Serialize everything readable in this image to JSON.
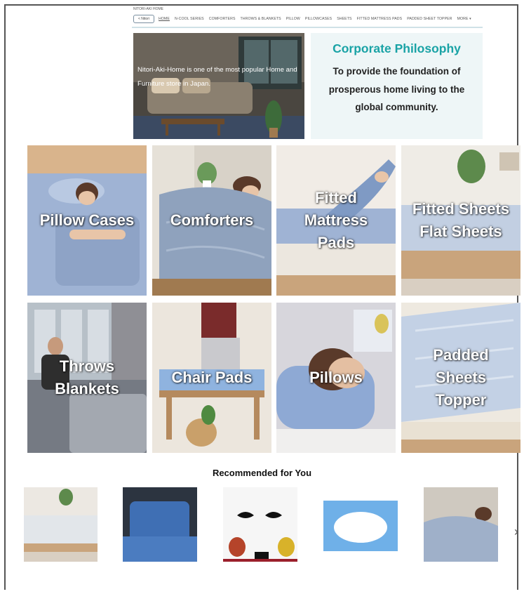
{
  "header": {
    "store_tag": "NITORI-AKI HOME",
    "nav_button": "< Nitori",
    "nav_items": [
      "HOME",
      "N-COOL SERIES",
      "COMFORTERS",
      "THROWS & BLANKETS",
      "PILLOW",
      "PILLOWCASES",
      "SHEETS",
      "FITTED MATTRESS PADS",
      "PADDED SHEET TOPPER",
      "MORE ▾"
    ]
  },
  "hero": {
    "text": "Nitori-Aki-Home is one of the most popular Home and Furniture store in Japan."
  },
  "philosophy": {
    "title": "Corporate Philosophy",
    "body": "To provide the foundation of prosperous home living to the global community."
  },
  "categories": [
    {
      "label": "Pillow Cases"
    },
    {
      "label": "Comforters"
    },
    {
      "label": "Fitted\nMattress\nPads"
    },
    {
      "label": "Fitted Sheets\nFlat Sheets"
    },
    {
      "label": "Throws\nBlankets"
    },
    {
      "label": "Chair Pads"
    },
    {
      "label": "Pillows"
    },
    {
      "label": "Padded\nSheets\nTopper"
    }
  ],
  "recommended": {
    "title": "Recommended for You",
    "prev": "‹",
    "next": "›"
  },
  "colors": {
    "accent_teal": "#1aa3a6",
    "bedding_blue": "#9fb3d4",
    "wood": "#c9a47c"
  }
}
